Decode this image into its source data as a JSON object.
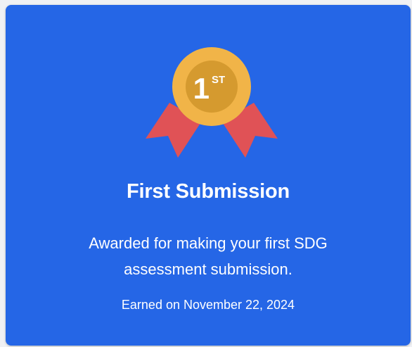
{
  "badge": {
    "title": "First Submission",
    "description": "Awarded for making your first SDG assessment submission.",
    "earned": "Earned on November 22, 2024",
    "medal_number": "1",
    "medal_suffix": "ST",
    "icon": "first-place-medal-icon",
    "colors": {
      "card": "#2566e6",
      "medal_outer": "#f1b448",
      "medal_inner": "#d59a2f",
      "ribbon": "#e05256"
    }
  }
}
